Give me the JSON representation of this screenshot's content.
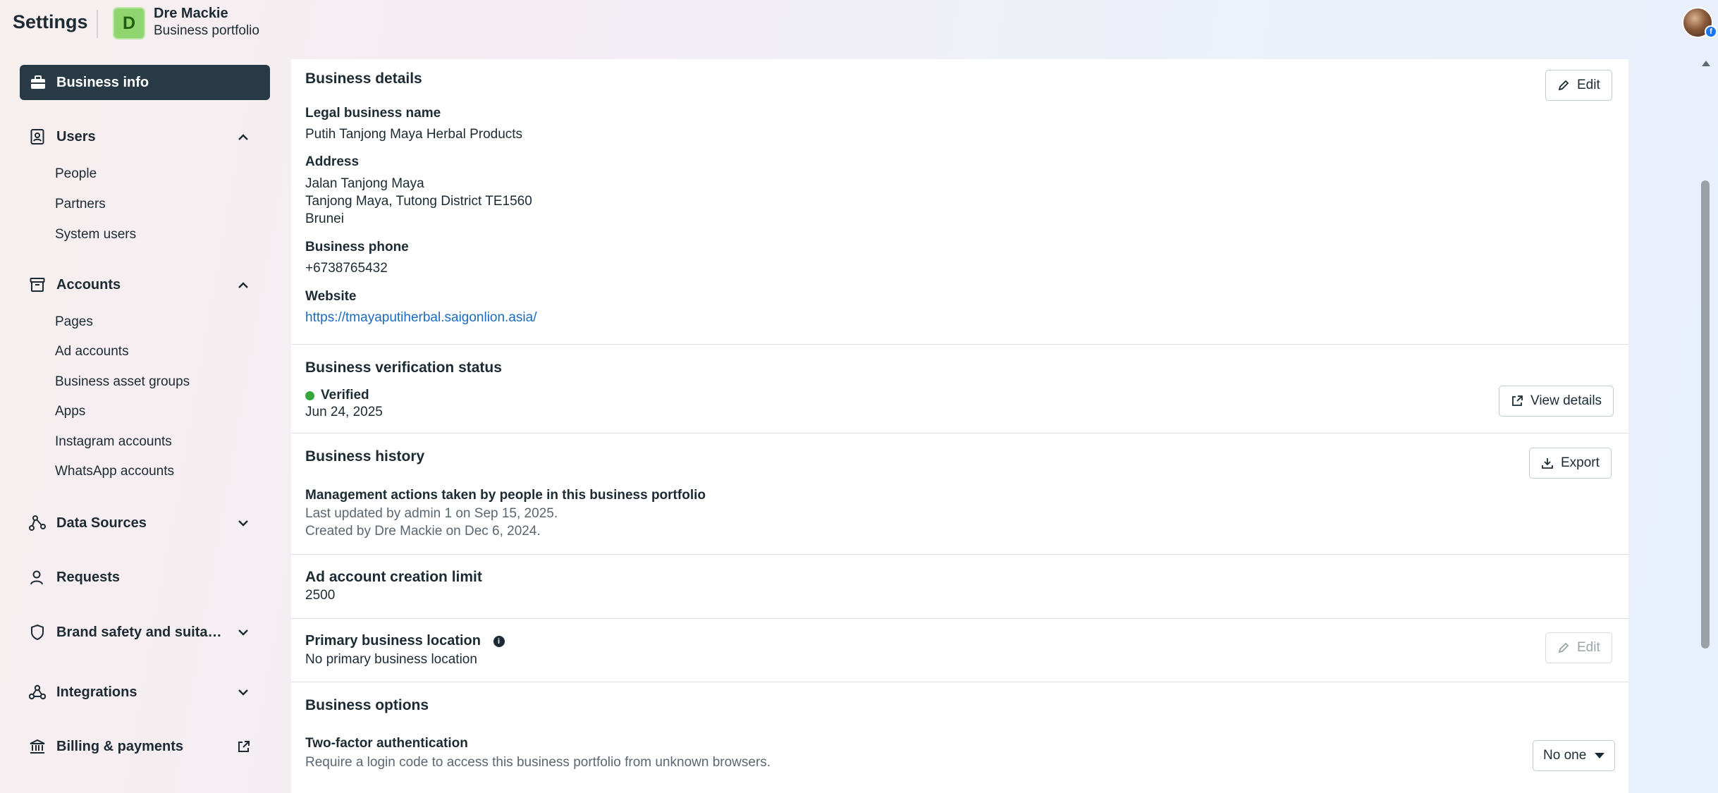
{
  "header": {
    "title": "Settings",
    "portfolio_initial": "D",
    "portfolio_name": "Dre Mackie",
    "portfolio_subtitle": "Business portfolio",
    "badge_letter": "f"
  },
  "sidebar": {
    "active_item": "Business info",
    "sections": [
      {
        "label": "Users",
        "expanded": true,
        "items": [
          "People",
          "Partners",
          "System users"
        ]
      },
      {
        "label": "Accounts",
        "expanded": true,
        "items": [
          "Pages",
          "Ad accounts",
          "Business asset groups",
          "Apps",
          "Instagram accounts",
          "WhatsApp accounts"
        ]
      },
      {
        "label": "Data Sources",
        "expanded": false
      },
      {
        "label": "Requests"
      },
      {
        "label": "Brand safety and suitabil...",
        "expanded": false
      },
      {
        "label": "Integrations",
        "expanded": false
      },
      {
        "label": "Billing & payments",
        "external": true
      }
    ]
  },
  "main": {
    "business_details": {
      "title": "Business details",
      "edit_label": "Edit",
      "legal_name_label": "Legal business name",
      "legal_name": "Putih Tanjong Maya Herbal Products",
      "address_label": "Address",
      "address_line1": "Jalan Tanjong Maya",
      "address_line2": "Tanjong Maya, Tutong District TE1560",
      "address_line3": "Brunei",
      "phone_label": "Business phone",
      "phone": "+6738765432",
      "website_label": "Website",
      "website": "https://tmayaputiherbal.saigonlion.asia/"
    },
    "verification": {
      "title": "Business verification status",
      "status": "Verified",
      "date": "Jun 24, 2025",
      "view_details_label": "View details"
    },
    "history": {
      "title": "Business history",
      "export_label": "Export",
      "subtitle": "Management actions taken by people in this business portfolio",
      "last_updated": "Last updated by admin 1 on Sep 15, 2025.",
      "created": "Created by Dre Mackie on Dec 6, 2024."
    },
    "ad_limit": {
      "title": "Ad account creation limit",
      "value": "2500"
    },
    "primary_location": {
      "title": "Primary business location",
      "value": "No primary business location",
      "edit_label": "Edit"
    },
    "options": {
      "title": "Business options",
      "twofa_label": "Two-factor authentication",
      "twofa_desc": "Require a login code to access this business portfolio from unknown browsers.",
      "twofa_value": "No one"
    }
  },
  "colors": {
    "sidebar_active_bg": "#283a46",
    "verified_green": "#36a73b",
    "link_blue": "#1a6bbf",
    "portfolio_avatar_green": "#8fd46e"
  },
  "icons": [
    "briefcase-icon",
    "id-badge-icon",
    "archive-box-icon",
    "data-sources-icon",
    "person-icon",
    "shield-icon",
    "integrations-icon",
    "bank-icon",
    "external-link-icon",
    "chevron-up-icon",
    "chevron-down-icon",
    "pencil-icon",
    "download-icon",
    "info-icon",
    "caret-down-icon"
  ]
}
